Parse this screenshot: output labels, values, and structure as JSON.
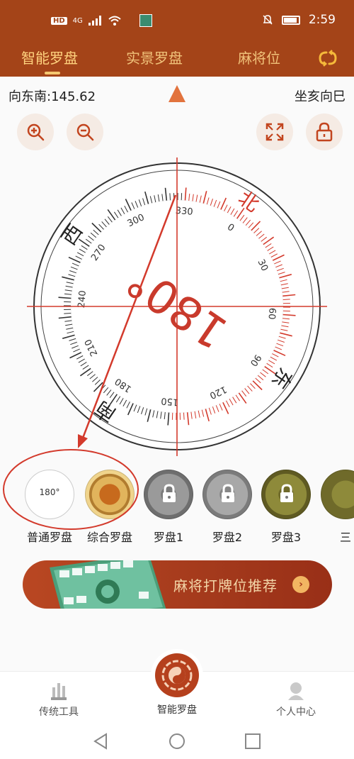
{
  "status_bar": {
    "hd": "HD",
    "network": "4G",
    "time": "2:59",
    "icons": [
      "signal-icon",
      "wifi-icon",
      "app-thumbnail-icon",
      "mute-bell-icon",
      "battery-icon"
    ]
  },
  "tabs": [
    {
      "label": "智能罗盘",
      "active": true
    },
    {
      "label": "实景罗盘",
      "active": false
    },
    {
      "label": "麻将位",
      "active": false
    }
  ],
  "heading": {
    "direction": "向东南:145.62",
    "sitting": "坐亥向巳"
  },
  "toolbar": {
    "icons": [
      "zoom-in-icon",
      "zoom-out-icon",
      "fullscreen-icon",
      "lock-icon"
    ]
  },
  "compass": {
    "center_reading": "180°",
    "directions": {
      "east": "东",
      "south": "南",
      "west": "西",
      "north": "北"
    },
    "degree_labels": [
      "0",
      "30",
      "60",
      "90",
      "120",
      "150",
      "180",
      "210",
      "240",
      "270",
      "300",
      "330"
    ],
    "heading_deg": 145.62
  },
  "pans": [
    {
      "label": "普通罗盘",
      "thumb_text": "180°",
      "locked": false
    },
    {
      "label": "综合罗盘",
      "locked": false
    },
    {
      "label": "罗盘1",
      "locked": true
    },
    {
      "label": "罗盘2",
      "locked": true
    },
    {
      "label": "罗盘3",
      "locked": true
    },
    {
      "label": "三",
      "locked": false
    }
  ],
  "banner": {
    "text": "麻将打牌位推荐",
    "arrow": "›"
  },
  "bottom_nav": {
    "left": "传统工具",
    "center": "智能罗盘",
    "right": "个人中心"
  },
  "colors": {
    "brand": "#a44418",
    "accent": "#ffd27e",
    "compass_red": "#d33a2c",
    "tab_text": "#f0c27a"
  }
}
